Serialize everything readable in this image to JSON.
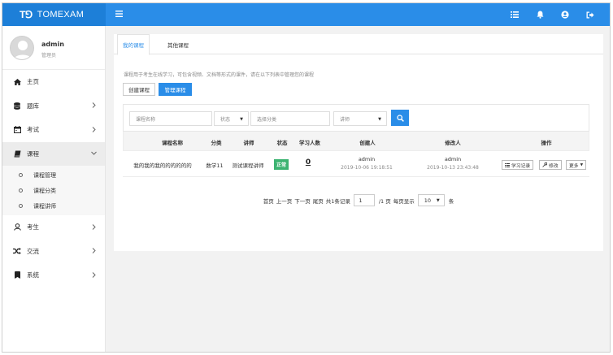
{
  "header": {
    "logo": "T⅁",
    "title": "TOMEXAM"
  },
  "user": {
    "name": "admin",
    "role": "管理员"
  },
  "sidebar": {
    "items": [
      {
        "label": "主页",
        "icon": "home-icon"
      },
      {
        "label": "题库",
        "icon": "database-icon"
      },
      {
        "label": "考试",
        "icon": "calendar-icon"
      },
      {
        "label": "课程",
        "icon": "book-icon"
      },
      {
        "label": "考生",
        "icon": "user-icon"
      },
      {
        "label": "交流",
        "icon": "shuffle-icon"
      },
      {
        "label": "系统",
        "icon": "bookmark-icon"
      }
    ],
    "course_sub": [
      "课程管理",
      "课程分类",
      "课程讲师"
    ]
  },
  "tabs": [
    "我的课程",
    "其他课程"
  ],
  "description": "课程用于考生在线学习，可包含视频、文档等形式的课件，请在以下列表中管理您的课程",
  "buttons": {
    "create": "创建课程",
    "manage": "管理课程"
  },
  "filter": {
    "name_placeholder": "课程名称",
    "state_placeholder": "状态",
    "category_placeholder": "选择分类",
    "teacher_placeholder": "讲师"
  },
  "table": {
    "headers": [
      "课程名称",
      "分类",
      "讲师",
      "状态",
      "学习人数",
      "创建人",
      "修改人",
      "操作"
    ],
    "rows": [
      {
        "name": "我的我的我的的的的的的",
        "category": "数学11",
        "teacher": "测试课程讲师",
        "status": "正常",
        "learners": "0",
        "creator": "admin",
        "created_at": "2019-10-06 19:18:51",
        "modifier": "admin",
        "modified_at": "2019-10-13 23:43:48",
        "actions": [
          "学习记录",
          "修改",
          "更多"
        ]
      }
    ]
  },
  "pagination": {
    "first": "首页",
    "prev": "上一页",
    "next": "下一页",
    "last": "尾页",
    "total": "共1条记录",
    "page": "1",
    "page_total": "/1 页",
    "per_page_label": "每页显示",
    "per_page": "10",
    "unit": "条"
  },
  "colors": {
    "primary": "#2a8de8",
    "success": "#3cb371"
  }
}
